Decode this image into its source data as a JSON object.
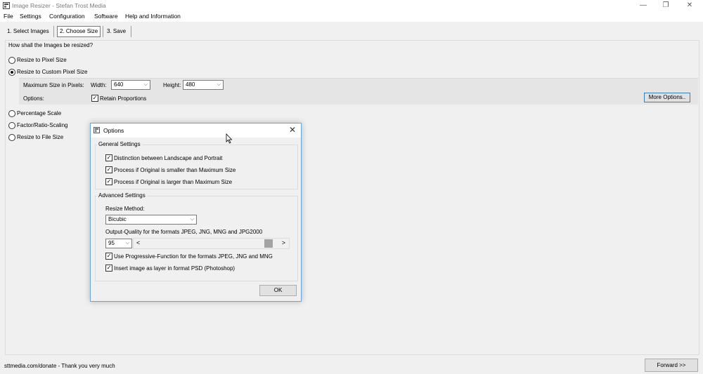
{
  "window": {
    "title": "Image Resizer - Stefan Trost Media",
    "controls": {
      "minimize": "—",
      "maximize": "❐",
      "close": "✕"
    }
  },
  "menu": [
    "File",
    "Settings",
    "Configuration",
    "Software",
    "Help and Information"
  ],
  "steps": [
    "1. Select Images",
    "2. Choose Size",
    "3. Save"
  ],
  "main": {
    "question": "How shall the Images be resized?",
    "options": {
      "pixel": "Resize to Pixel Size",
      "custom": "Resize to Custom Pixel Size",
      "percentage": "Percentage Scale",
      "factor": "Factor/Ratio-Scaling",
      "file_size": "Resize to File Size"
    },
    "selected_option": "custom",
    "custom": {
      "max_size_label": "Maximum Size in Pixels:",
      "width_label": "Width:",
      "width_value": "640",
      "height_label": "Height:",
      "height_value": "480",
      "options_label": "Options:",
      "retain_label": "Retain Proportions",
      "more_options": "More Options.."
    }
  },
  "status": {
    "text": "sttmedia.com/donate - Thank you very much",
    "forward": "Forward >>"
  },
  "dialog": {
    "title": "Options",
    "close": "✕",
    "general": {
      "label": "General Settings",
      "items": [
        "Distinction between Landscape and Portrait",
        "Process if Original is smaller than Maximum Size",
        "Process if Original is larger than Maximum Size"
      ]
    },
    "advanced": {
      "label": "Advanced Settings",
      "resize_method_label": "Resize Method:",
      "resize_method_value": "Bicubic",
      "quality_label": "Output-Quality for the formats JPEG, JNG, MNG and JPG2000",
      "quality_value": "95",
      "scroll_left": "<",
      "scroll_right": ">",
      "items": [
        "Use Progressive-Function for the formats JPEG, JNG and MNG",
        "Insert image as layer in format PSD (Photoshop)"
      ]
    },
    "ok": "OK"
  },
  "glyphs": {
    "check": "✓",
    "chevron": "⌵"
  },
  "colors": {
    "dialog_border": "#6aa4d9",
    "scroll_thumb": "#a3a3a3"
  }
}
